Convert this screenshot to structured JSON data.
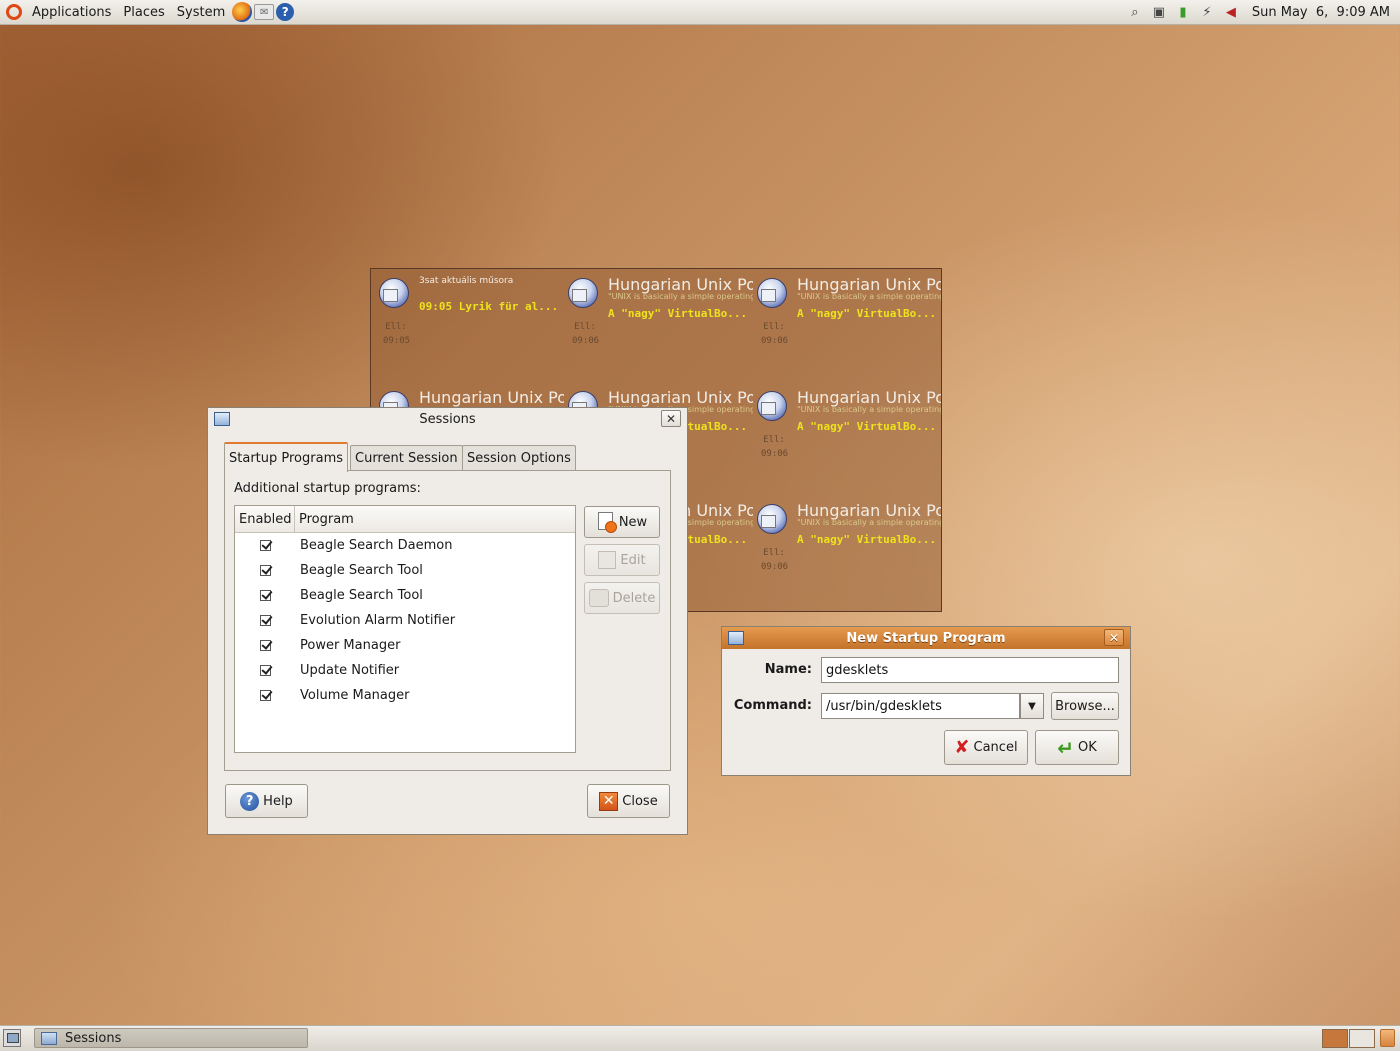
{
  "top_panel": {
    "menus": [
      "Applications",
      "Places",
      "System"
    ],
    "launchers": [
      "firefox-icon",
      "mail-icon",
      "help-icon"
    ],
    "tray_icons": [
      "search-icon",
      "network-icon",
      "battery-icon",
      "power-plug-icon",
      "volume-icon"
    ],
    "clock": "Sun May  6,  9:09 AM"
  },
  "desklet": {
    "feeds": [
      {
        "title": "3sat aktuális műsora",
        "subtitle": "",
        "item": "09:05 Lyrik für al...",
        "ell": "Ell:",
        "time": "09:05"
      },
      {
        "title": "Hungarian Unix Portal",
        "subtitle": "\"UNIX is basically a simple operating system\"",
        "item": "A \"nagy\" VirtualBo...",
        "ell": "Ell:",
        "time": "09:06"
      },
      {
        "title": "Hungarian Unix Portal",
        "subtitle": "\"UNIX is basically a simple operating system\"",
        "item": "A \"nagy\" VirtualBo...",
        "ell": "Ell:",
        "time": "09:06"
      },
      {
        "title": "Hungarian Unix Portal",
        "subtitle": "",
        "item": "",
        "ell": "",
        "time": ""
      },
      {
        "title": "Hungarian Unix Portal",
        "subtitle": "\"UNIX is basically a simple operating system\"",
        "item": "A \"nagy\" VirtualBo...",
        "ell": "",
        "time": ""
      },
      {
        "title": "Hungarian Unix Portal",
        "subtitle": "\"UNIX is basically a simple operating system\"",
        "item": "A \"nagy\" VirtualBo...",
        "ell": "Ell:",
        "time": "09:06"
      },
      {
        "title": "Hungarian Unix Portal",
        "subtitle": "\"UNIX is basically a simple operating system\"",
        "item": "A \"nagy\" VirtualBo...",
        "ell": "",
        "time": ""
      },
      {
        "title": "Hungarian Unix Portal",
        "subtitle": "\"UNIX is basically a simple operating system\"",
        "item": "A \"nagy\" VirtualBo...",
        "ell": "Ell:",
        "time": "09:06"
      }
    ]
  },
  "sessions": {
    "title": "Sessions",
    "tabs": [
      "Startup Programs",
      "Current Session",
      "Session Options"
    ],
    "heading": "Additional startup programs:",
    "columns": {
      "enabled": "Enabled",
      "program": "Program"
    },
    "programs": [
      {
        "name": "Beagle Search Daemon",
        "enabled": true
      },
      {
        "name": "Beagle Search Tool",
        "enabled": true
      },
      {
        "name": "Beagle Search Tool",
        "enabled": true
      },
      {
        "name": "Evolution Alarm Notifier",
        "enabled": true
      },
      {
        "name": "Power Manager",
        "enabled": true
      },
      {
        "name": "Update Notifier",
        "enabled": true
      },
      {
        "name": "Volume Manager",
        "enabled": true
      }
    ],
    "buttons": {
      "new": "New",
      "edit": "Edit",
      "delete": "Delete",
      "help": "Help",
      "close": "Close"
    }
  },
  "new_startup": {
    "title": "New Startup Program",
    "name_label": "Name:",
    "name_value": "gdesklets",
    "command_label": "Command:",
    "command_value": "/usr/bin/gdesklets",
    "browse": "Browse...",
    "cancel": "Cancel",
    "ok": "OK"
  },
  "taskbar": {
    "task": "Sessions"
  },
  "colors": {
    "accent": "#e07a2e",
    "titlebar_active": "#d07f36",
    "feed_item": "#eee21c"
  }
}
